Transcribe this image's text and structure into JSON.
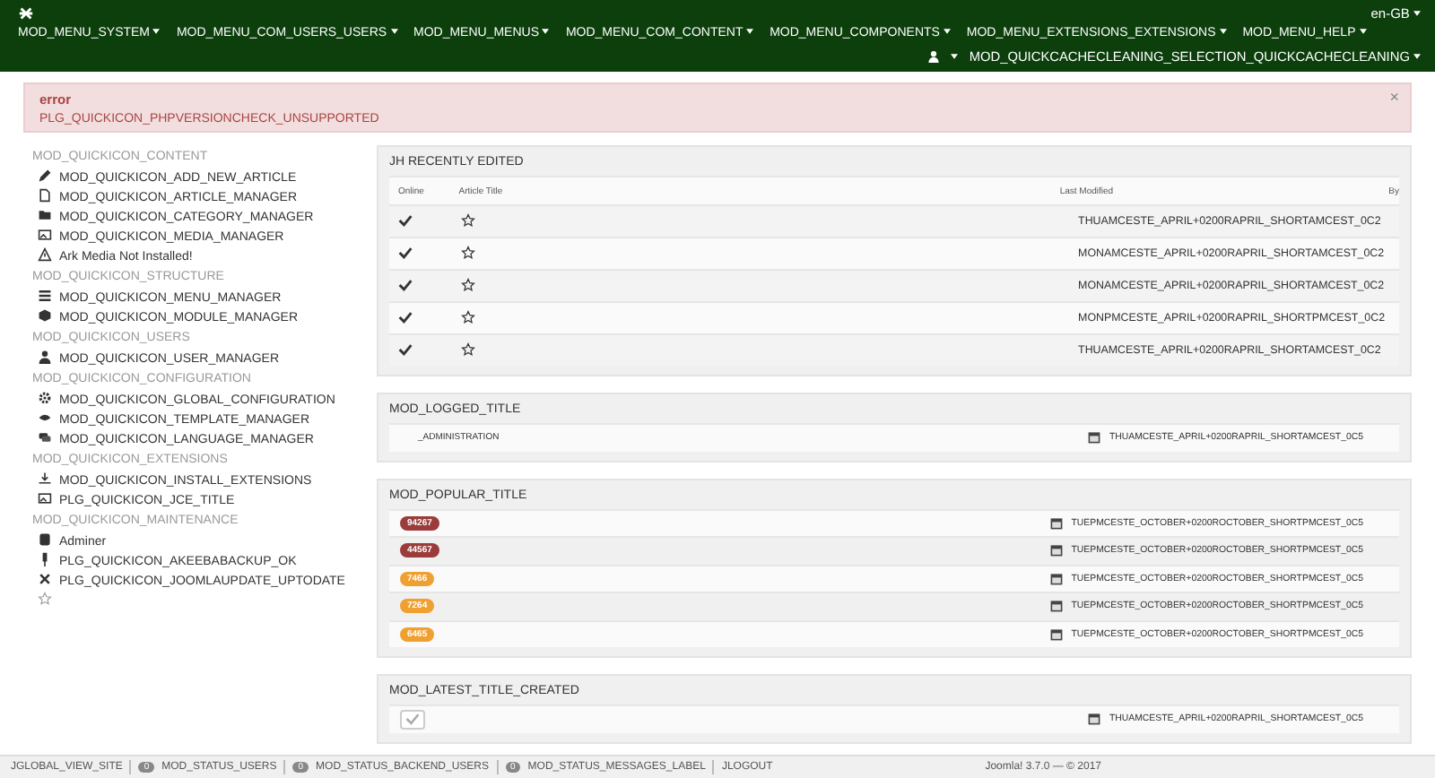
{
  "header": {
    "language": "en-GB",
    "menu": [
      "MOD_MENU_SYSTEM",
      "MOD_MENU_COM_USERS_USERS",
      "MOD_MENU_MENUS",
      "MOD_MENU_COM_CONTENT",
      "MOD_MENU_COMPONENTS",
      "MOD_MENU_EXTENSIONS_EXTENSIONS",
      "MOD_MENU_HELP"
    ],
    "cache_menu": "MOD_QUICKCACHECLEANING_SELECTION_QUICKCACHECLEANING"
  },
  "alert": {
    "title": "error",
    "message": "PLG_QUICKICON_PHPVERSIONCHECK_UNSUPPORTED",
    "close": "×"
  },
  "sidebar": [
    {
      "heading": "MOD_QUICKICON_CONTENT",
      "items": [
        "MOD_QUICKICON_ADD_NEW_ARTICLE",
        "MOD_QUICKICON_ARTICLE_MANAGER",
        "MOD_QUICKICON_CATEGORY_MANAGER",
        "MOD_QUICKICON_MEDIA_MANAGER",
        "Ark Media Not Installed!"
      ]
    },
    {
      "heading": "MOD_QUICKICON_STRUCTURE",
      "items": [
        "MOD_QUICKICON_MENU_MANAGER",
        "MOD_QUICKICON_MODULE_MANAGER"
      ]
    },
    {
      "heading": "MOD_QUICKICON_USERS",
      "items": [
        "MOD_QUICKICON_USER_MANAGER"
      ]
    },
    {
      "heading": "MOD_QUICKICON_CONFIGURATION",
      "items": [
        "MOD_QUICKICON_GLOBAL_CONFIGURATION",
        "MOD_QUICKICON_TEMPLATE_MANAGER",
        "MOD_QUICKICON_LANGUAGE_MANAGER"
      ]
    },
    {
      "heading": "MOD_QUICKICON_EXTENSIONS",
      "items": [
        "MOD_QUICKICON_INSTALL_EXTENSIONS",
        "PLG_QUICKICON_JCE_TITLE"
      ]
    },
    {
      "heading": "MOD_QUICKICON_MAINTENANCE",
      "items": [
        "Adminer",
        "PLG_QUICKICON_AKEEBABACKUP_OK",
        "PLG_QUICKICON_JOOMLAUPDATE_UPTODATE"
      ]
    }
  ],
  "recent": {
    "title": "JH RECENTLY EDITED",
    "columns": [
      "Online",
      "Article Title",
      "Last Modified",
      "By"
    ],
    "rows": [
      {
        "published": true,
        "featured": false,
        "modified": "THUAMCESTE_APRIL+0200RAPRIL_SHORTAMCEST_0C2"
      },
      {
        "published": true,
        "featured": false,
        "modified": "MONAMCESTE_APRIL+0200RAPRIL_SHORTAMCEST_0C2"
      },
      {
        "published": true,
        "featured": false,
        "modified": "MONAMCESTE_APRIL+0200RAPRIL_SHORTAMCEST_0C2"
      },
      {
        "published": true,
        "featured": false,
        "modified": "MONPMCESTE_APRIL+0200RAPRIL_SHORTPMCEST_0C2"
      },
      {
        "published": true,
        "featured": false,
        "modified": "THUAMCESTE_APRIL+0200RAPRIL_SHORTAMCEST_0C2"
      }
    ]
  },
  "logged": {
    "title": "MOD_LOGGED_TITLE",
    "rows": [
      {
        "name": "_ADMINISTRATION",
        "date": "THUAMCESTE_APRIL+0200RAPRIL_SHORTAMCEST_0C5"
      }
    ]
  },
  "popular": {
    "title": "MOD_POPULAR_TITLE",
    "rows": [
      {
        "hits": "94267",
        "color": "#9b3b3b",
        "date": "TUEPMCESTE_OCTOBER+0200ROCTOBER_SHORTPMCEST_0C5"
      },
      {
        "hits": "44567",
        "color": "#9b3b3b",
        "date": "TUEPMCESTE_OCTOBER+0200ROCTOBER_SHORTPMCEST_0C5"
      },
      {
        "hits": "7466",
        "color": "#f0a030",
        "date": "TUEPMCESTE_OCTOBER+0200ROCTOBER_SHORTPMCEST_0C5"
      },
      {
        "hits": "7264",
        "color": "#f0a030",
        "date": "TUEPMCESTE_OCTOBER+0200ROCTOBER_SHORTPMCEST_0C5"
      },
      {
        "hits": "6465",
        "color": "#f0a030",
        "date": "TUEPMCESTE_OCTOBER+0200ROCTOBER_SHORTPMCEST_0C5"
      }
    ]
  },
  "latest": {
    "title": "MOD_LATEST_TITLE_CREATED",
    "rows": [
      {
        "published": true,
        "date": "THUAMCESTE_APRIL+0200RAPRIL_SHORTAMCEST_0C5"
      }
    ]
  },
  "status_bar": {
    "view_site": "JGLOBAL_VIEW_SITE",
    "badges": [
      {
        "count": "0",
        "label": "MOD_STATUS_USERS"
      },
      {
        "count": "0",
        "label": "MOD_STATUS_BACKEND_USERS"
      },
      {
        "count": "0",
        "label": "MOD_STATUS_MESSAGES_LABEL"
      }
    ],
    "logout": "JLOGOUT",
    "footer": "Joomla! 3.7.0 — © 2017"
  }
}
